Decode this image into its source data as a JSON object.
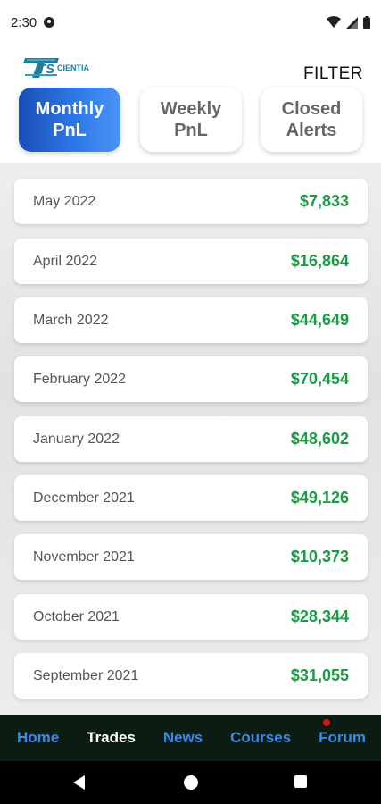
{
  "status_bar": {
    "time": "2:30",
    "icons": [
      "data-saver-icon",
      "wifi-icon",
      "cell-signal-icon",
      "battery-icon"
    ]
  },
  "header": {
    "logo_text_big": "TS",
    "logo_text_small": "CIENTIA",
    "filter_label": "FILTER"
  },
  "tabs": [
    {
      "label": "Monthly\nPnL",
      "active": true
    },
    {
      "label": "Weekly\nPnL",
      "active": false
    },
    {
      "label": "Closed\nAlerts",
      "active": false
    }
  ],
  "pnl_rows": [
    {
      "month": "May 2022",
      "value": "$7,833"
    },
    {
      "month": "April 2022",
      "value": "$16,864"
    },
    {
      "month": "March 2022",
      "value": "$44,649"
    },
    {
      "month": "February 2022",
      "value": "$70,454"
    },
    {
      "month": "January 2022",
      "value": "$48,602"
    },
    {
      "month": "December 2021",
      "value": "$49,126"
    },
    {
      "month": "November 2021",
      "value": "$10,373"
    },
    {
      "month": "October 2021",
      "value": "$28,344"
    },
    {
      "month": "September 2021",
      "value": "$31,055"
    }
  ],
  "bottom_nav": [
    {
      "label": "Home",
      "active": false
    },
    {
      "label": "Trades",
      "active": true
    },
    {
      "label": "News",
      "active": false
    },
    {
      "label": "Courses",
      "active": false
    },
    {
      "label": "Forum",
      "active": false,
      "notification": true
    }
  ],
  "colors": {
    "accent": "#2f7bea",
    "positive": "#1d9a45",
    "nav_bg": "#0b1c12",
    "nav_link": "#3a8ae8"
  }
}
